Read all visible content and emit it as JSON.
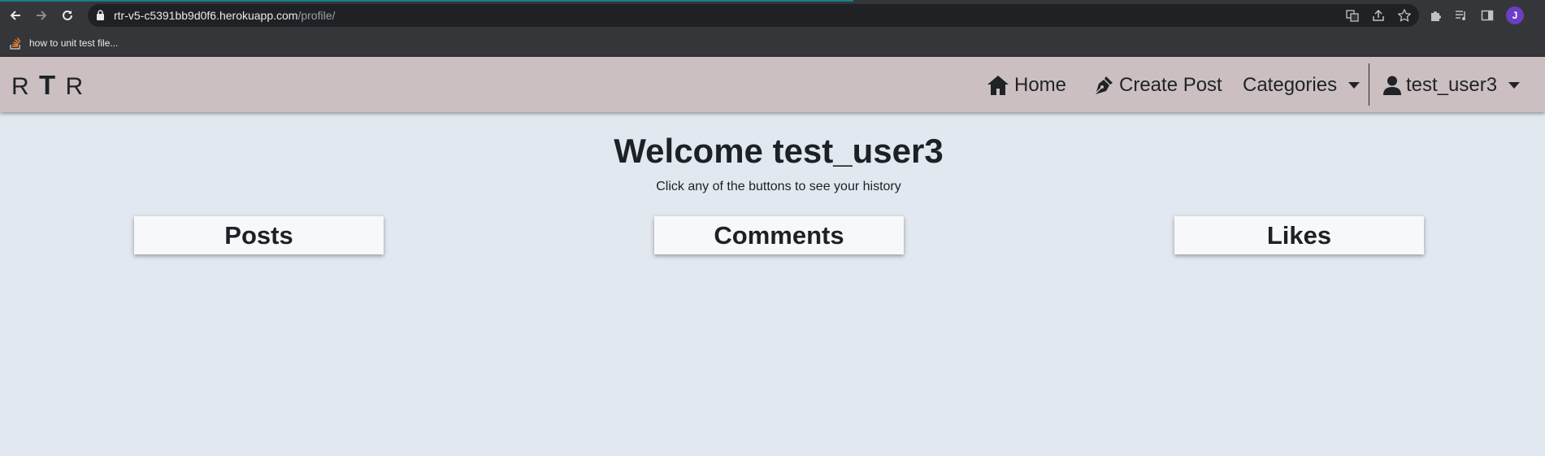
{
  "browser": {
    "url_host": "rtr-v5-c5391bb9d0f6.herokuapp.com",
    "url_path": "/profile/",
    "avatar_initial": "J",
    "bookmark_label": "how to unit test file..."
  },
  "navbar": {
    "brand_left": "R",
    "brand_mid": "T",
    "brand_right": "R",
    "home_label": "Home",
    "create_post_label": "Create Post",
    "categories_label": "Categories",
    "user_label": "test_user3"
  },
  "main": {
    "welcome": "Welcome test_user3",
    "subtitle": "Click any of the buttons to see your history",
    "buttons": [
      "Posts",
      "Comments",
      "Likes"
    ]
  },
  "colors": {
    "navbar_bg": "#cbbfc1",
    "page_bg": "#e2e8ef",
    "text": "#1c2126",
    "chrome_bg": "#35363a",
    "avatar": "#6a3fc4"
  }
}
